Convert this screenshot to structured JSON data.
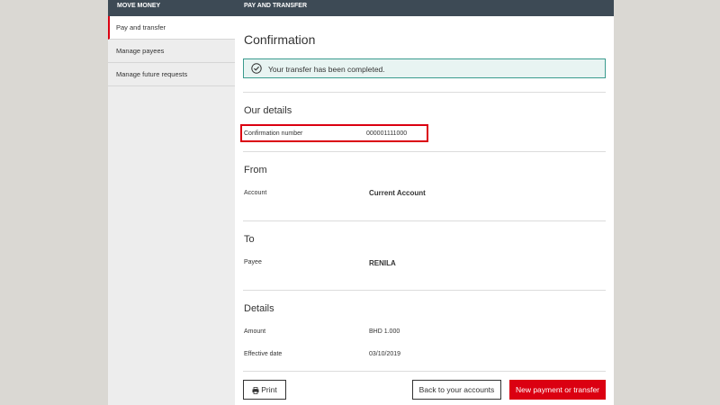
{
  "sidebar": {
    "header": "MOVE MONEY",
    "items": [
      {
        "label": "Pay and transfer"
      },
      {
        "label": "Manage payees"
      },
      {
        "label": "Manage future requests"
      }
    ]
  },
  "main": {
    "header": "PAY AND TRANSFER",
    "title": "Confirmation",
    "success_message": "Your transfer has been completed."
  },
  "our_details": {
    "title": "Our details",
    "confirmation_label": "Confirmation number",
    "confirmation_value": "000001111000"
  },
  "from": {
    "title": "From",
    "account_label": "Account",
    "account_value": "Current Account"
  },
  "to": {
    "title": "To",
    "payee_label": "Payee",
    "payee_value": "RENILA"
  },
  "details": {
    "title": "Details",
    "amount_label": "Amount",
    "amount_value": "BHD 1.000",
    "date_label": "Effective date",
    "date_value": "03/10/2019"
  },
  "actions": {
    "print_label": "Print",
    "back_label": "Back to your accounts",
    "new_label": "New payment or transfer"
  },
  "colors": {
    "header_bg": "#3d4a55",
    "accent_red": "#db0011",
    "success_border": "#3a9b8e",
    "success_bg": "#e8f4f2"
  }
}
